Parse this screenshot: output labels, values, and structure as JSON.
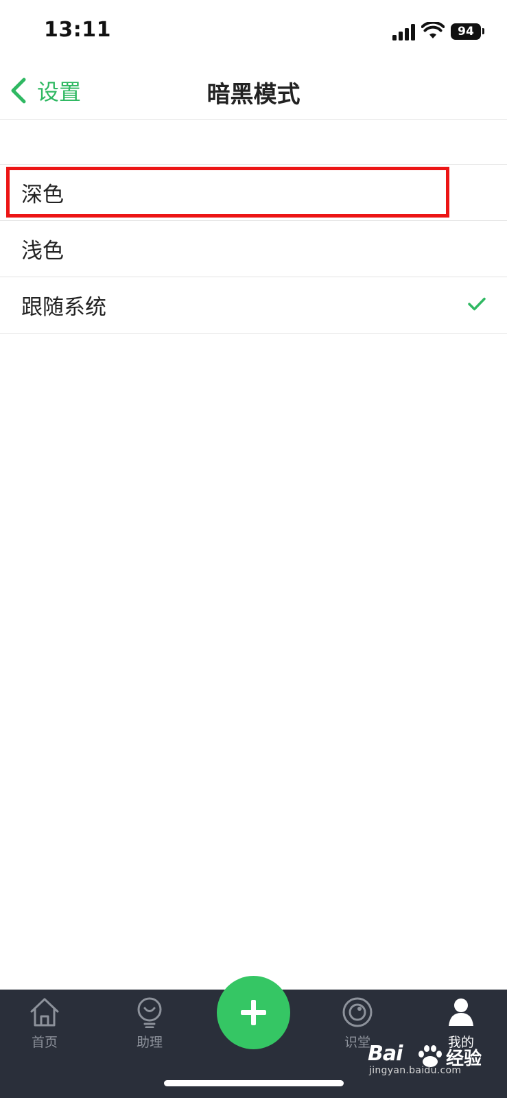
{
  "status_bar": {
    "time": "13:11",
    "battery": "94"
  },
  "nav": {
    "back_label": "设置",
    "title": "暗黑模式"
  },
  "options": [
    {
      "label": "深色",
      "selected": false
    },
    {
      "label": "浅色",
      "selected": false
    },
    {
      "label": "跟随系统",
      "selected": true
    }
  ],
  "tabs": [
    {
      "label": "首页",
      "icon": "home-icon",
      "active": false
    },
    {
      "label": "助理",
      "icon": "lightbulb-icon",
      "active": false
    },
    {
      "label": "识堂",
      "icon": "smile-circle-icon",
      "active": false
    },
    {
      "label": "我的",
      "icon": "person-icon",
      "active": true
    }
  ],
  "fab": {
    "icon": "plus-icon"
  },
  "watermark": {
    "logo": "Bai",
    "suffix": "经验",
    "url": "jingyan.baidu.com"
  },
  "colors": {
    "accent": "#2fb862",
    "fab": "#35c664",
    "highlight": "#ec1515",
    "tab_bar": "#2a2f3a"
  }
}
